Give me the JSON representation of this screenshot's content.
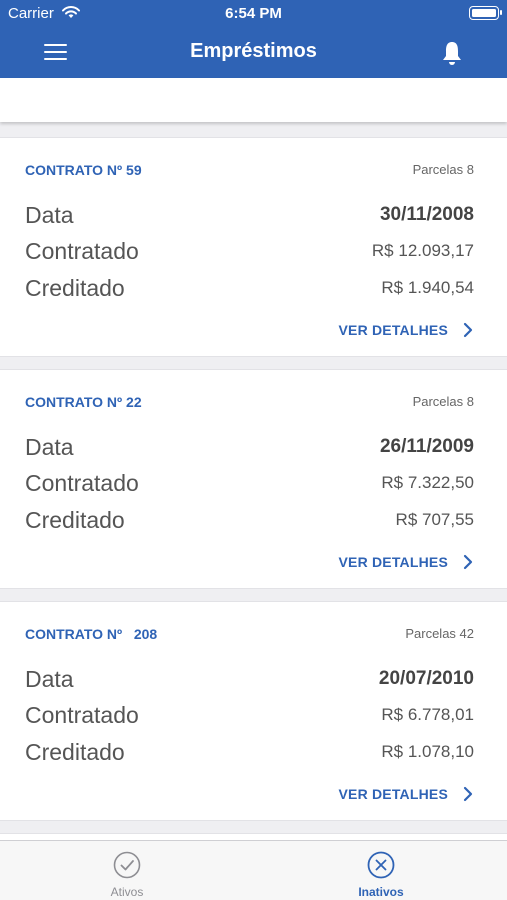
{
  "status_bar": {
    "carrier": "Carrier",
    "time": "6:54 PM"
  },
  "header": {
    "title": "Empréstimos",
    "menu_icon": "hamburger-menu-icon",
    "bell_icon": "bell-icon"
  },
  "contracts": [
    {
      "title": "CONTRATO Nº 59",
      "parcelas": "Parcelas   8",
      "data_label": "Data",
      "data_value": "30/11/2008",
      "contratado_label": "Contratado",
      "contratado_value": "R$ 12.093,17",
      "creditado_label": "Creditado",
      "creditado_value": "R$ 1.940,54",
      "link": "VER DETALHES"
    },
    {
      "title": "CONTRATO Nº 22",
      "parcelas": "Parcelas   8",
      "data_label": "Data",
      "data_value": "26/11/2009",
      "contratado_label": "Contratado",
      "contratado_value": "R$ 7.322,50",
      "creditado_label": "Creditado",
      "creditado_value": "R$ 707,55",
      "link": "VER DETALHES"
    },
    {
      "title": "CONTRATO Nº   208",
      "parcelas": "Parcelas 42",
      "data_label": "Data",
      "data_value": "20/07/2010",
      "contratado_label": "Contratado",
      "contratado_value": "R$ 6.778,01",
      "creditado_label": "Creditado",
      "creditado_value": "R$ 1.078,10",
      "link": "VER DETALHES"
    }
  ],
  "tabs": [
    {
      "label": "Ativos",
      "icon": "check-circle-icon",
      "active": false
    },
    {
      "label": "Inativos",
      "icon": "x-circle-icon",
      "active": true
    }
  ],
  "colors": {
    "primary": "#2f63b5",
    "inactive_tab": "#8e8e93",
    "background": "#efeff2"
  }
}
